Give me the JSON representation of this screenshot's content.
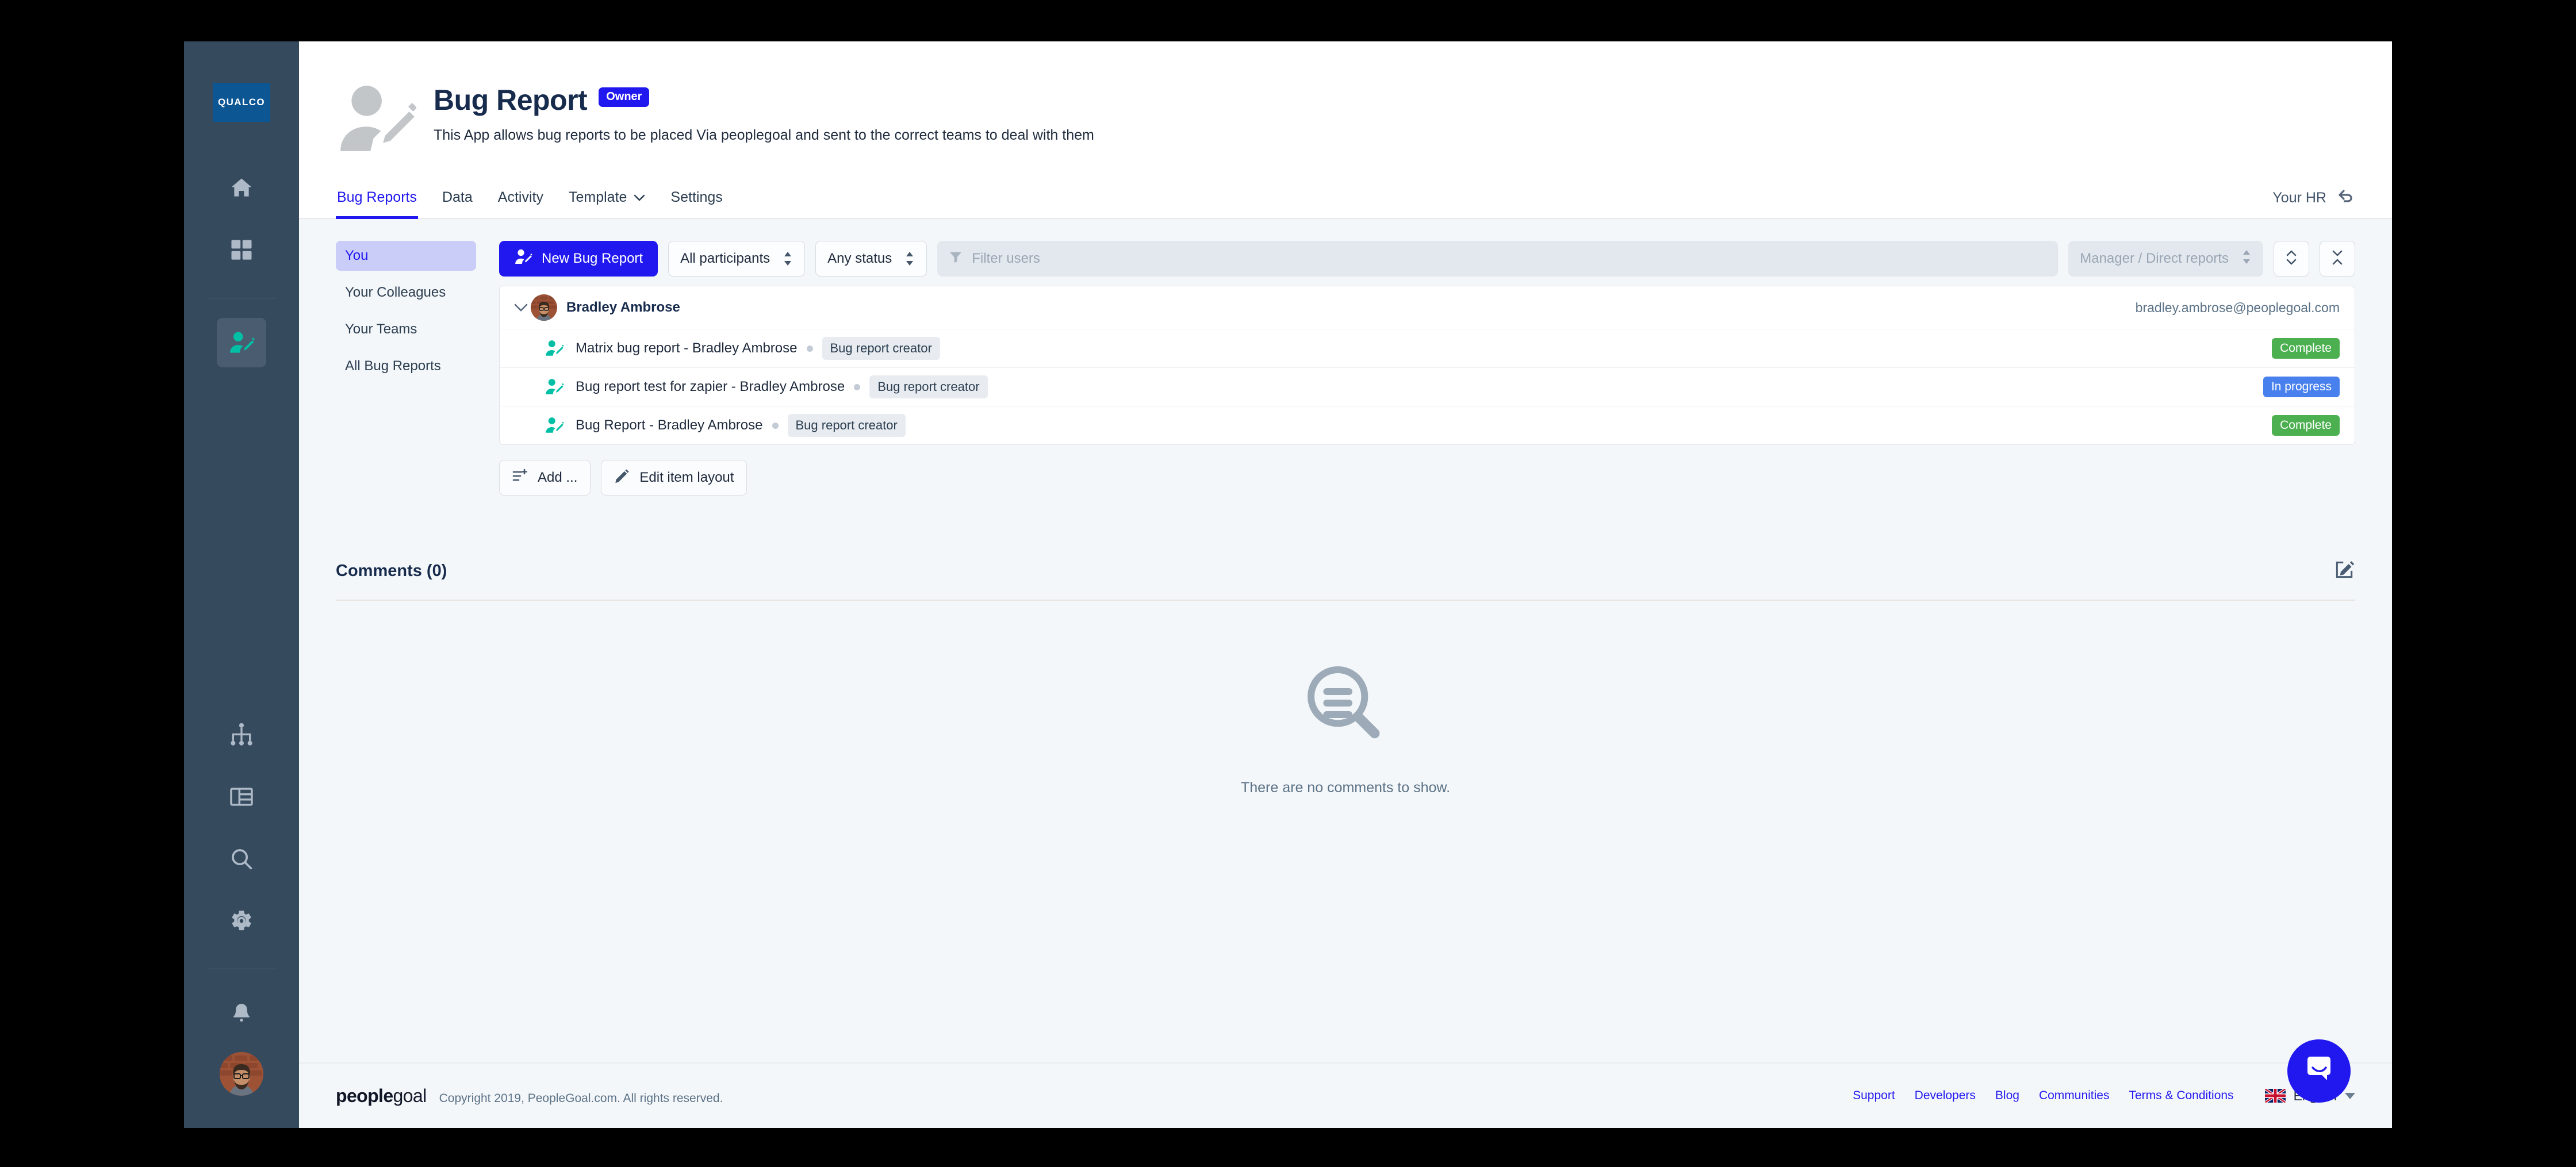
{
  "rail": {
    "logo_text": "QUALCO",
    "icons": [
      {
        "name": "home-icon",
        "label": "Home"
      },
      {
        "name": "grid-icon",
        "label": "Apps"
      },
      {
        "name": "user-edit-icon",
        "label": "Bug Report App",
        "active": true
      },
      {
        "name": "org-chart-icon",
        "label": "Org chart"
      },
      {
        "name": "table-icon",
        "label": "Reports"
      },
      {
        "name": "search-icon",
        "label": "Search"
      },
      {
        "name": "gear-icon",
        "label": "Settings"
      },
      {
        "name": "bell-icon",
        "label": "Notifications"
      }
    ]
  },
  "header": {
    "title": "Bug Report",
    "badge": "Owner",
    "subtitle": "This App allows bug reports to be placed Via peoplegoal and sent to the correct teams to deal with them"
  },
  "tabs": [
    {
      "label": "Bug Reports",
      "active": true,
      "caret": false
    },
    {
      "label": "Data",
      "active": false,
      "caret": false
    },
    {
      "label": "Activity",
      "active": false,
      "caret": false
    },
    {
      "label": "Template",
      "active": false,
      "caret": true
    },
    {
      "label": "Settings",
      "active": false,
      "caret": false
    }
  ],
  "your_hr": {
    "label": "Your HR"
  },
  "side_nav": [
    {
      "label": "You",
      "active": true
    },
    {
      "label": "Your Colleagues",
      "active": false
    },
    {
      "label": "Your Teams",
      "active": false
    },
    {
      "label": "All Bug Reports",
      "active": false
    }
  ],
  "toolbar": {
    "new_button": "New Bug Report",
    "participants_select": "All participants",
    "status_select": "Any status",
    "filter_placeholder": "Filter users",
    "manager_select": "Manager / Direct reports"
  },
  "list": {
    "group": {
      "name": "Bradley Ambrose",
      "email": "bradley.ambrose@peoplegoal.com"
    },
    "items": [
      {
        "title": "Matrix bug report - Bradley Ambrose",
        "role": "Bug report creator",
        "status": "Complete",
        "status_color": "#4caf50"
      },
      {
        "title": "Bug report test for zapier - Bradley Ambrose",
        "role": "Bug report creator",
        "status": "In progress",
        "status_color": "#4880ed"
      },
      {
        "title": "Bug Report - Bradley Ambrose",
        "role": "Bug report creator",
        "status": "Complete",
        "status_color": "#4caf50"
      }
    ]
  },
  "actions": {
    "add_label": "Add ...",
    "edit_layout_label": "Edit item layout"
  },
  "comments": {
    "title": "Comments (0)",
    "empty_text": "There are no comments to show."
  },
  "footer": {
    "logo_bold": "people",
    "logo_light": "goal",
    "copyright": "Copyright 2019, PeopleGoal.com. All rights reserved.",
    "links": [
      "Support",
      "Developers",
      "Blog",
      "Communities",
      "Terms & Conditions"
    ],
    "language": "English"
  },
  "colors": {
    "accent": "#2118ef",
    "rail": "#364a5e",
    "teal": "#00bfa5",
    "logo_blue": "#0d5694"
  }
}
